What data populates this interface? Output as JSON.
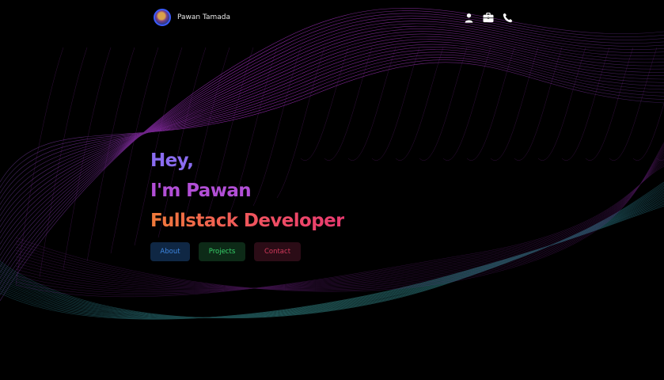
{
  "header": {
    "name": "Pawan Tamada",
    "nav_icons": [
      "user-icon",
      "briefcase-icon",
      "phone-icon"
    ]
  },
  "hero": {
    "line1": "Hey,",
    "line2": "I'm Pawan",
    "line3": "Fullstack Developer"
  },
  "buttons": {
    "about": "About",
    "projects": "Projects",
    "contact": "Contact"
  },
  "colors": {
    "background": "#000000",
    "line1": "#8a6cf0",
    "line2": "#b24fd6",
    "line3_start": "#f07a3a",
    "line3_end": "#e83a70",
    "wave_magenta": "#a42bc0",
    "wave_teal": "#1f6a78"
  }
}
